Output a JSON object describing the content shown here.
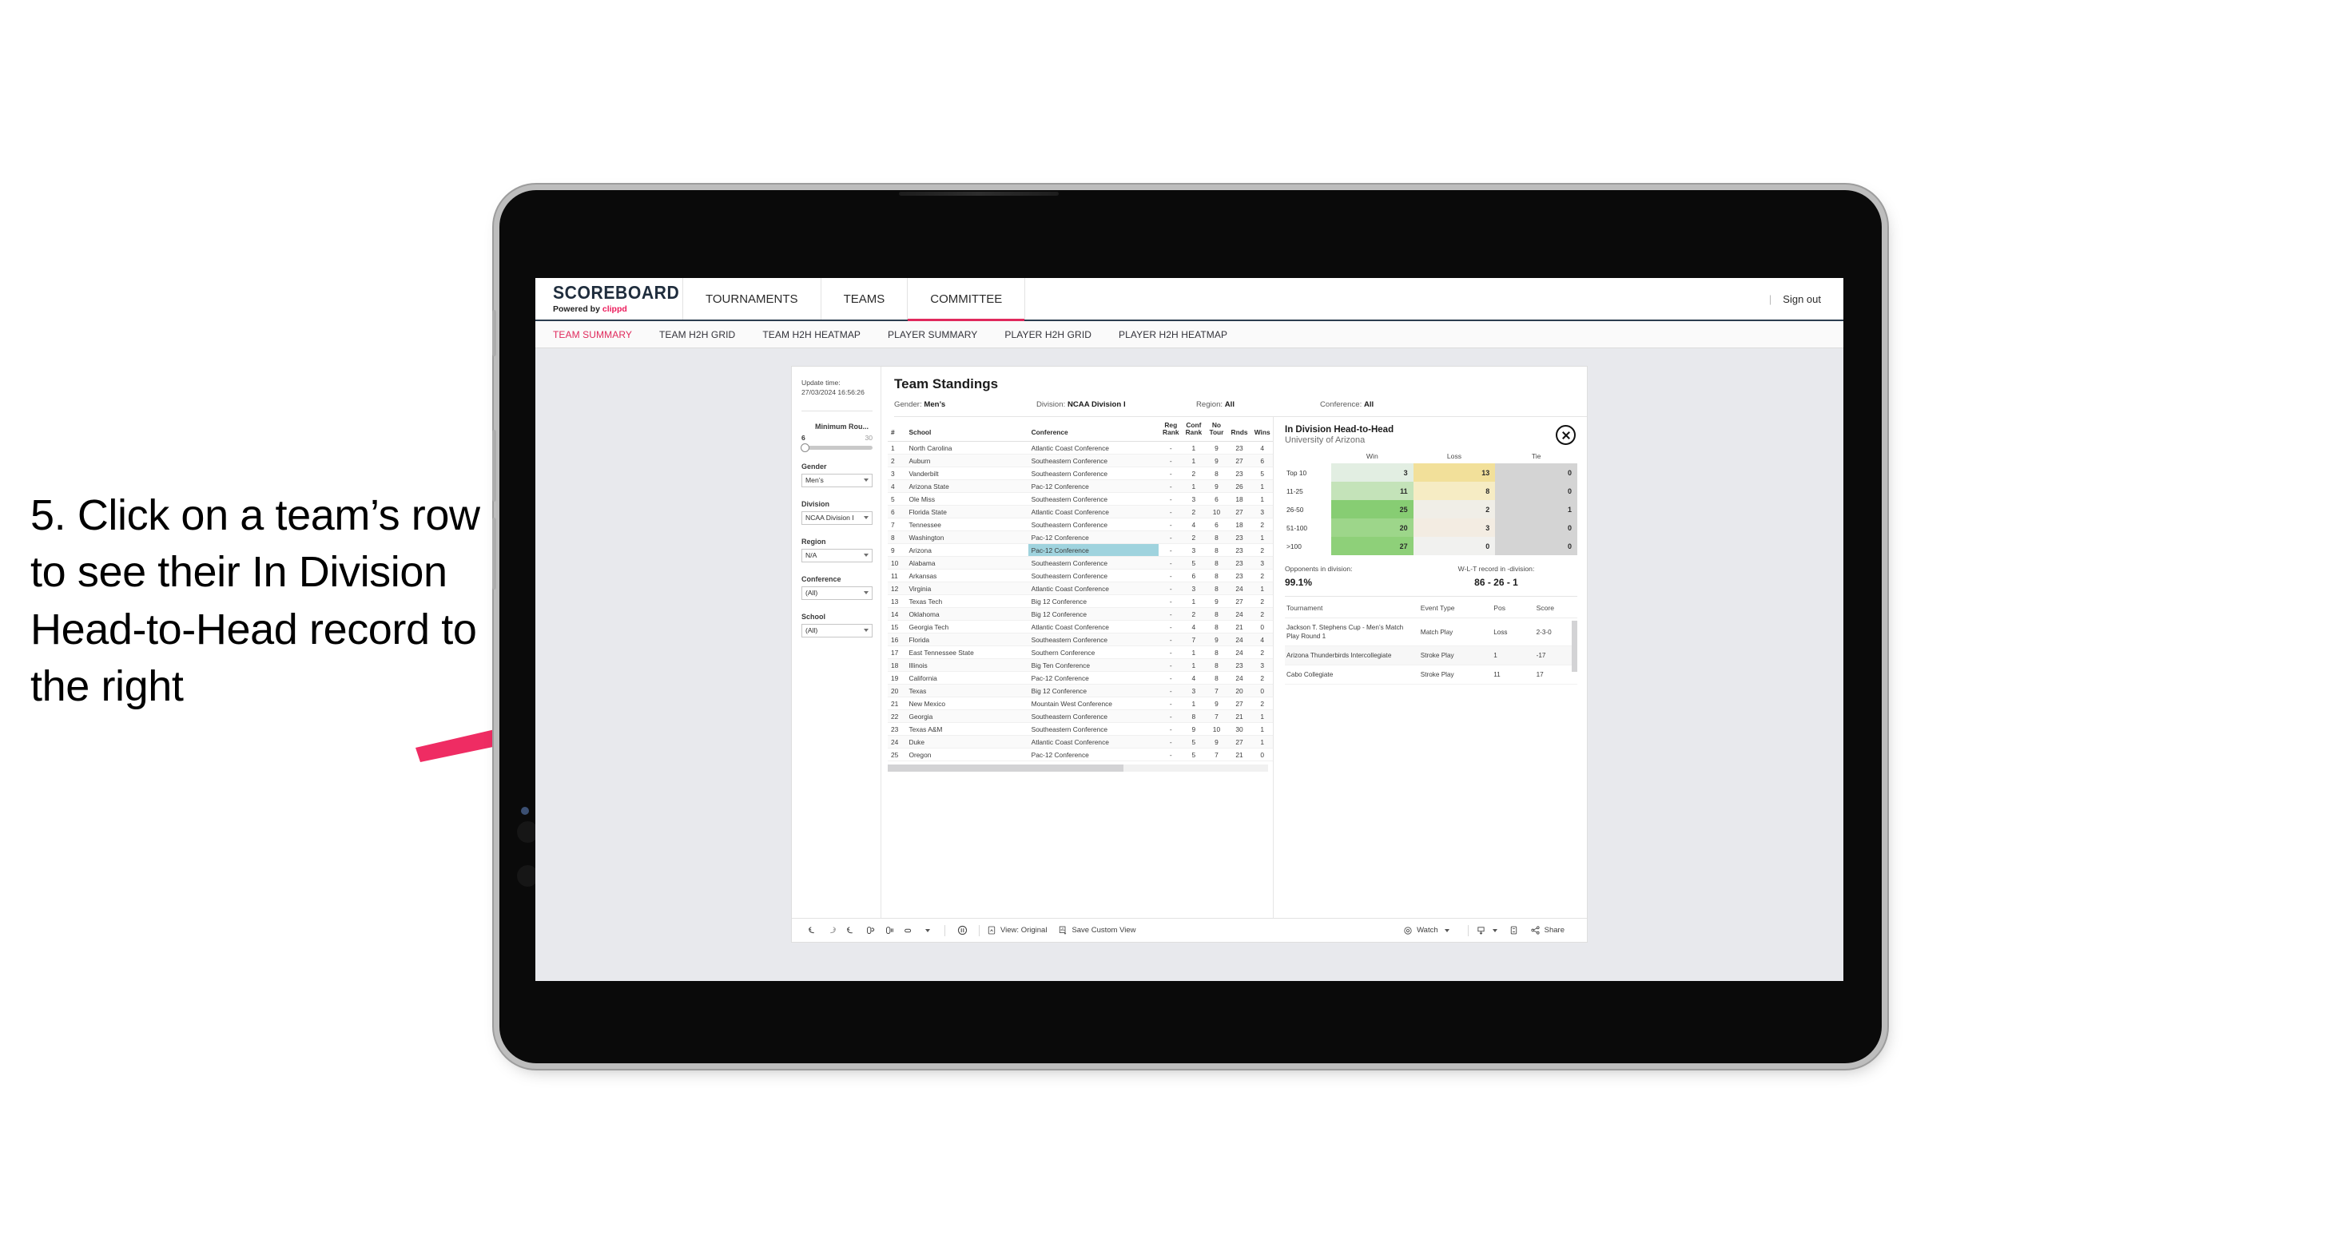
{
  "annotation": {
    "text": "5. Click on a team’s row to see their In Division Head-to-Head record to the right",
    "arrow_color": "#ef2c63"
  },
  "app": {
    "logo": {
      "main": "SCOREBOARD",
      "powered_by": "Powered by",
      "brand": "clippd"
    },
    "nav_tabs": [
      {
        "label": "TOURNAMENTS",
        "active": false
      },
      {
        "label": "TEAMS",
        "active": false
      },
      {
        "label": "COMMITTEE",
        "active": true
      }
    ],
    "sign_out": "Sign out",
    "divider": "|",
    "sub_tabs": [
      {
        "label": "TEAM SUMMARY",
        "active": true
      },
      {
        "label": "TEAM H2H GRID",
        "active": false
      },
      {
        "label": "TEAM H2H HEATMAP",
        "active": false
      },
      {
        "label": "PLAYER SUMMARY",
        "active": false
      },
      {
        "label": "PLAYER H2H GRID",
        "active": false
      },
      {
        "label": "PLAYER H2H HEATMAP",
        "active": false
      }
    ]
  },
  "filters": {
    "update_time_label": "Update time:",
    "update_time_value": "27/03/2024 16:56:26",
    "slider": {
      "label": "Minimum Rou...",
      "min": "6",
      "max": "30"
    },
    "selects": [
      {
        "label": "Gender",
        "value": "Men’s"
      },
      {
        "label": "Division",
        "value": "NCAA Division I"
      },
      {
        "label": "Region",
        "value": "N/A"
      },
      {
        "label": "Conference",
        "value": "(All)"
      },
      {
        "label": "School",
        "value": "(All)"
      }
    ]
  },
  "sheet": {
    "title": "Team Standings",
    "meta": [
      {
        "label": "Gender:",
        "value": "Men’s"
      },
      {
        "label": "Division:",
        "value": "NCAA Division I"
      },
      {
        "label": "Region:",
        "value": "All"
      },
      {
        "label": "Conference:",
        "value": "All"
      }
    ],
    "columns": [
      "#",
      "School",
      "Conference",
      "Reg Rank",
      "Conf Rank",
      "No Tour",
      "Rnds",
      "Wins"
    ],
    "columns_split": [
      {
        "l1": "#",
        "l2": ""
      },
      {
        "l1": "School",
        "l2": ""
      },
      {
        "l1": "Conference",
        "l2": ""
      },
      {
        "l1": "Reg",
        "l2": "Rank"
      },
      {
        "l1": "Conf",
        "l2": "Rank"
      },
      {
        "l1": "No",
        "l2": "Tour"
      },
      {
        "l1": "",
        "l2": "Rnds"
      },
      {
        "l1": "",
        "l2": "Wins"
      }
    ],
    "rows": [
      {
        "n": "1",
        "school": "North Carolina",
        "conf": "Atlantic Coast Conference",
        "reg": "-",
        "cr": "1",
        "nt": "9",
        "rnds": "23",
        "wins": "4",
        "hl": false
      },
      {
        "n": "2",
        "school": "Auburn",
        "conf": "Southeastern Conference",
        "reg": "-",
        "cr": "1",
        "nt": "9",
        "rnds": "27",
        "wins": "6",
        "hl": false
      },
      {
        "n": "3",
        "school": "Vanderbilt",
        "conf": "Southeastern Conference",
        "reg": "-",
        "cr": "2",
        "nt": "8",
        "rnds": "23",
        "wins": "5",
        "hl": false
      },
      {
        "n": "4",
        "school": "Arizona State",
        "conf": "Pac-12 Conference",
        "reg": "-",
        "cr": "1",
        "nt": "9",
        "rnds": "26",
        "wins": "1",
        "hl": false
      },
      {
        "n": "5",
        "school": "Ole Miss",
        "conf": "Southeastern Conference",
        "reg": "-",
        "cr": "3",
        "nt": "6",
        "rnds": "18",
        "wins": "1",
        "hl": false
      },
      {
        "n": "6",
        "school": "Florida State",
        "conf": "Atlantic Coast Conference",
        "reg": "-",
        "cr": "2",
        "nt": "10",
        "rnds": "27",
        "wins": "3",
        "hl": false
      },
      {
        "n": "7",
        "school": "Tennessee",
        "conf": "Southeastern Conference",
        "reg": "-",
        "cr": "4",
        "nt": "6",
        "rnds": "18",
        "wins": "2",
        "hl": false
      },
      {
        "n": "8",
        "school": "Washington",
        "conf": "Pac-12 Conference",
        "reg": "-",
        "cr": "2",
        "nt": "8",
        "rnds": "23",
        "wins": "1",
        "hl": false
      },
      {
        "n": "9",
        "school": "Arizona",
        "conf": "Pac-12 Conference",
        "reg": "-",
        "cr": "3",
        "nt": "8",
        "rnds": "23",
        "wins": "2",
        "hl": true
      },
      {
        "n": "10",
        "school": "Alabama",
        "conf": "Southeastern Conference",
        "reg": "-",
        "cr": "5",
        "nt": "8",
        "rnds": "23",
        "wins": "3",
        "hl": false
      },
      {
        "n": "11",
        "school": "Arkansas",
        "conf": "Southeastern Conference",
        "reg": "-",
        "cr": "6",
        "nt": "8",
        "rnds": "23",
        "wins": "2",
        "hl": false
      },
      {
        "n": "12",
        "school": "Virginia",
        "conf": "Atlantic Coast Conference",
        "reg": "-",
        "cr": "3",
        "nt": "8",
        "rnds": "24",
        "wins": "1",
        "hl": false
      },
      {
        "n": "13",
        "school": "Texas Tech",
        "conf": "Big 12 Conference",
        "reg": "-",
        "cr": "1",
        "nt": "9",
        "rnds": "27",
        "wins": "2",
        "hl": false
      },
      {
        "n": "14",
        "school": "Oklahoma",
        "conf": "Big 12 Conference",
        "reg": "-",
        "cr": "2",
        "nt": "8",
        "rnds": "24",
        "wins": "2",
        "hl": false
      },
      {
        "n": "15",
        "school": "Georgia Tech",
        "conf": "Atlantic Coast Conference",
        "reg": "-",
        "cr": "4",
        "nt": "8",
        "rnds": "21",
        "wins": "0",
        "hl": false
      },
      {
        "n": "16",
        "school": "Florida",
        "conf": "Southeastern Conference",
        "reg": "-",
        "cr": "7",
        "nt": "9",
        "rnds": "24",
        "wins": "4",
        "hl": false
      },
      {
        "n": "17",
        "school": "East Tennessee State",
        "conf": "Southern Conference",
        "reg": "-",
        "cr": "1",
        "nt": "8",
        "rnds": "24",
        "wins": "2",
        "hl": false
      },
      {
        "n": "18",
        "school": "Illinois",
        "conf": "Big Ten Conference",
        "reg": "-",
        "cr": "1",
        "nt": "8",
        "rnds": "23",
        "wins": "3",
        "hl": false
      },
      {
        "n": "19",
        "school": "California",
        "conf": "Pac-12 Conference",
        "reg": "-",
        "cr": "4",
        "nt": "8",
        "rnds": "24",
        "wins": "2",
        "hl": false
      },
      {
        "n": "20",
        "school": "Texas",
        "conf": "Big 12 Conference",
        "reg": "-",
        "cr": "3",
        "nt": "7",
        "rnds": "20",
        "wins": "0",
        "hl": false
      },
      {
        "n": "21",
        "school": "New Mexico",
        "conf": "Mountain West Conference",
        "reg": "-",
        "cr": "1",
        "nt": "9",
        "rnds": "27",
        "wins": "2",
        "hl": false
      },
      {
        "n": "22",
        "school": "Georgia",
        "conf": "Southeastern Conference",
        "reg": "-",
        "cr": "8",
        "nt": "7",
        "rnds": "21",
        "wins": "1",
        "hl": false
      },
      {
        "n": "23",
        "school": "Texas A&M",
        "conf": "Southeastern Conference",
        "reg": "-",
        "cr": "9",
        "nt": "10",
        "rnds": "30",
        "wins": "1",
        "hl": false
      },
      {
        "n": "24",
        "school": "Duke",
        "conf": "Atlantic Coast Conference",
        "reg": "-",
        "cr": "5",
        "nt": "9",
        "rnds": "27",
        "wins": "1",
        "hl": false
      },
      {
        "n": "25",
        "school": "Oregon",
        "conf": "Pac-12 Conference",
        "reg": "-",
        "cr": "5",
        "nt": "7",
        "rnds": "21",
        "wins": "0",
        "hl": false
      }
    ]
  },
  "detail": {
    "title": "In Division Head-to-Head",
    "subtitle": "University of Arizona",
    "close_icon": "close-icon",
    "opponents_label": "Opponents in division:",
    "opponents_value": "99.1%",
    "record_label": "W-L-T record in -division:",
    "record_value": "86 - 26 - 1",
    "tourn_columns": [
      "Tournament",
      "Event Type",
      "Pos",
      "Score"
    ],
    "tournaments": [
      {
        "name": "Jackson T. Stephens Cup - Men’s Match Play Round 1",
        "type": "Match Play",
        "pos": "Loss",
        "score": "2-3-0"
      },
      {
        "name": "Arizona Thunderbirds Intercollegiate",
        "type": "Stroke Play",
        "pos": "1",
        "score": "-17"
      },
      {
        "name": "Cabo Collegiate",
        "type": "Stroke Play",
        "pos": "11",
        "score": "17"
      }
    ]
  },
  "chart_data": {
    "type": "heatmap",
    "title": "In Division Head-to-Head",
    "subtitle": "University of Arizona",
    "xlabel": "",
    "ylabel": "",
    "columns": [
      "Win",
      "Loss",
      "Tie"
    ],
    "categories": [
      "Top 10",
      "11-25",
      "26-50",
      "51-100",
      ">100"
    ],
    "series": [
      {
        "name": "Win",
        "values": [
          3,
          11,
          25,
          20,
          27
        ]
      },
      {
        "name": "Loss",
        "values": [
          13,
          8,
          2,
          3,
          0
        ]
      },
      {
        "name": "Tie",
        "values": [
          0,
          0,
          1,
          0,
          0
        ]
      }
    ],
    "cell_colors": {
      "win": [
        "#e2eee2",
        "#c4e3b9",
        "#87cd73",
        "#9dd68a",
        "#8ed079"
      ],
      "loss": [
        "#f2e09a",
        "#f6ecc4",
        "#f0eee7",
        "#f3ece2",
        "#f1f1ef"
      ],
      "tie": [
        "#d4d4d4",
        "#d4d4d4",
        "#d4d4d4",
        "#d4d4d4",
        "#d4d4d4"
      ]
    },
    "legend_position": "top",
    "grid": false
  },
  "toolbar": {
    "icons": [
      "undo-icon",
      "redo-icon",
      "revert-icon",
      "refresh-icon",
      "pause-icon",
      "shape-icon"
    ],
    "view_label": "View: Original",
    "save_label": "Save Custom View",
    "watch_label": "Watch",
    "share_label": "Share",
    "download_icon": "download-icon",
    "fullscreen_icon": "fullscreen-icon"
  }
}
